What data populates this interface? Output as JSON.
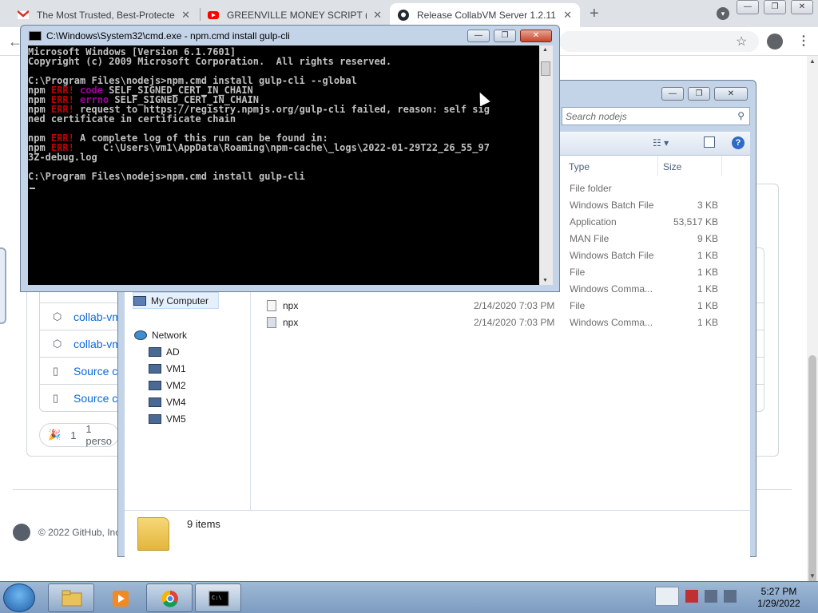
{
  "browser": {
    "tabs": [
      {
        "title": "The Most Trusted, Best-Protected",
        "icon": "gmail-icon",
        "active": false
      },
      {
        "title": "GREENVILLE MONEY SCRIPT (WO",
        "icon": "youtube-icon",
        "active": false
      },
      {
        "title": "Release CollabVM Server 1.2.11",
        "icon": "github-icon",
        "active": true
      }
    ],
    "new_tab_label": "+"
  },
  "github": {
    "assets": [
      {
        "label": "collab-vm",
        "icon": "package-icon"
      },
      {
        "label": "collab-vm",
        "icon": "package-icon"
      },
      {
        "label": "Source co",
        "icon": "file-zip-icon"
      },
      {
        "label": "Source co",
        "icon": "file-zip-icon"
      }
    ],
    "reaction_count": "1",
    "reaction_text": "1 perso",
    "copyright": "© 2022 GitHub, Inc"
  },
  "explorer": {
    "search_placeholder": "Search nodejs",
    "columns": {
      "type": "Type",
      "size": "Size"
    },
    "files": [
      {
        "name": "",
        "date": "",
        "type": "File folder",
        "size": ""
      },
      {
        "name": "",
        "date": "",
        "type": "Windows Batch File",
        "size": "3 KB"
      },
      {
        "name": "",
        "date": "",
        "type": "Application",
        "size": "53,517 KB"
      },
      {
        "name": "",
        "date": "",
        "type": "MAN File",
        "size": "9 KB"
      },
      {
        "name": "",
        "date": "",
        "type": "Windows Batch File",
        "size": "1 KB"
      },
      {
        "name": "",
        "date": "",
        "type": "File",
        "size": "1 KB"
      },
      {
        "name": "",
        "date": "",
        "type": "Windows Comma...",
        "size": "1 KB"
      },
      {
        "name": "npx",
        "date": "2/14/2020 7:03 PM",
        "type": "File",
        "size": "1 KB"
      },
      {
        "name": "npx",
        "date": "2/14/2020 7:03 PM",
        "type": "Windows Comma...",
        "size": "1 KB"
      }
    ],
    "nav": {
      "my_computer": "My Computer",
      "network": "Network",
      "hosts": [
        "AD",
        "VM1",
        "VM2",
        "VM4",
        "VM5"
      ]
    },
    "item_count": "9 items"
  },
  "cmd": {
    "title": "C:\\Windows\\System32\\cmd.exe - npm.cmd  install gulp-cli",
    "lines": [
      [
        {
          "t": "Microsoft Windows [Version 6.1.7601]",
          "c": ""
        }
      ],
      [
        {
          "t": "Copyright (c) 2009 Microsoft Corporation.  All rights reserved.",
          "c": ""
        }
      ],
      [
        {
          "t": "",
          "c": ""
        }
      ],
      [
        {
          "t": "C:\\Program Files\\nodejs>npm.cmd install gulp-cli --global",
          "c": ""
        }
      ],
      [
        {
          "t": "npm ",
          "c": ""
        },
        {
          "t": "ERR!",
          "c": "red"
        },
        {
          "t": " code",
          "c": "mag"
        },
        {
          "t": " SELF_SIGNED_CERT_IN_CHAIN",
          "c": ""
        }
      ],
      [
        {
          "t": "npm ",
          "c": ""
        },
        {
          "t": "ERR!",
          "c": "red"
        },
        {
          "t": " errno",
          "c": "mag"
        },
        {
          "t": " SELF_SIGNED_CERT_IN_CHAIN",
          "c": ""
        }
      ],
      [
        {
          "t": "npm ",
          "c": ""
        },
        {
          "t": "ERR!",
          "c": "red"
        },
        {
          "t": " request to https://registry.npmjs.org/gulp-cli failed, reason: self sig",
          "c": ""
        }
      ],
      [
        {
          "t": "ned certificate in certificate chain",
          "c": ""
        }
      ],
      [
        {
          "t": "",
          "c": ""
        }
      ],
      [
        {
          "t": "npm ",
          "c": ""
        },
        {
          "t": "ERR!",
          "c": "red"
        },
        {
          "t": " A complete log of this run can be found in:",
          "c": ""
        }
      ],
      [
        {
          "t": "npm ",
          "c": ""
        },
        {
          "t": "ERR!",
          "c": "red"
        },
        {
          "t": "     C:\\Users\\vm1\\AppData\\Roaming\\npm-cache\\_logs\\2022-01-29T22_26_55_97",
          "c": ""
        }
      ],
      [
        {
          "t": "3Z-debug.log",
          "c": ""
        }
      ],
      [
        {
          "t": "",
          "c": ""
        }
      ],
      [
        {
          "t": "C:\\Program Files\\nodejs>npm.cmd install gulp-cli",
          "c": ""
        }
      ]
    ]
  },
  "taskbar": {
    "time": "5:27 PM",
    "date": "1/29/2022"
  },
  "colors": {
    "cmd_bg": "#000000",
    "cmd_text": "#c0c0c0",
    "err_red": "#c00000",
    "err_magenta": "#a000a0",
    "link_blue": "#0969da"
  }
}
